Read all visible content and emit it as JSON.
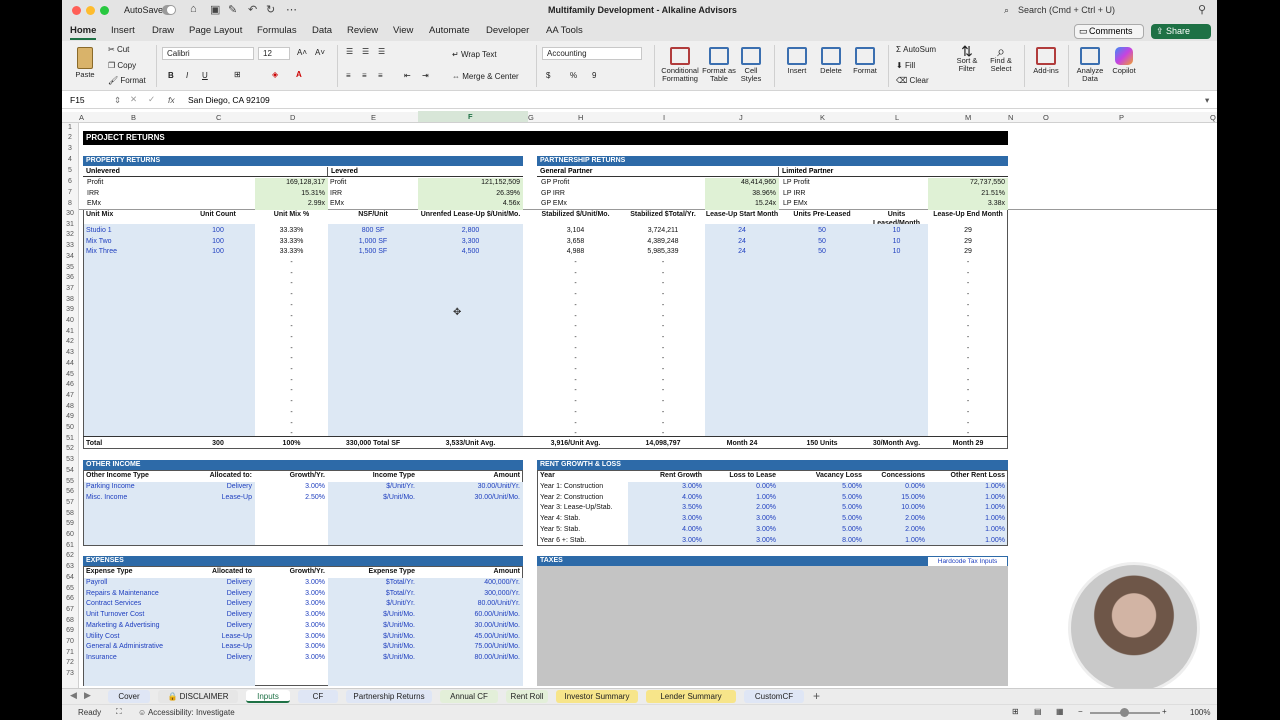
{
  "window": {
    "autosave": "AutoSave",
    "title": "Multifamily Development - Alkaline Advisors",
    "search": "Search (Cmd + Ctrl + U)"
  },
  "menu": {
    "tabs": [
      "Home",
      "Insert",
      "Draw",
      "Page Layout",
      "Formulas",
      "Data",
      "Review",
      "View",
      "Automate",
      "Developer",
      "AA Tools"
    ],
    "comments": "Comments",
    "share": "Share"
  },
  "ribbon": {
    "paste": "Paste",
    "cut": "Cut",
    "copy": "Copy",
    "format": "Format",
    "font": "Calibri",
    "size": "12",
    "wrap": "Wrap Text",
    "merge": "Merge & Center",
    "numfmt": "Accounting",
    "cond": "Conditional Formatting",
    "fmt_table": "Format as Table",
    "cell_styles": "Cell Styles",
    "ins": "Insert",
    "del": "Delete",
    "fmt": "Format",
    "autosum": "AutoSum",
    "fill": "Fill",
    "clear": "Clear",
    "sort": "Sort & Filter",
    "find": "Find & Select",
    "addins": "Add-ins",
    "analyze": "Analyze Data",
    "copilot": "Copilot"
  },
  "formula": {
    "cellref": "F15",
    "fx": "fx",
    "value": "San Diego, CA 92109"
  },
  "columns": [
    "A",
    "B",
    "C",
    "D",
    "E",
    "F",
    "G",
    "H",
    "I",
    "J",
    "K",
    "L",
    "M",
    "N",
    "O",
    "P",
    "Q"
  ],
  "rows_top": [
    "1",
    "2",
    "3",
    "4",
    "5",
    "6",
    "7",
    "8"
  ],
  "rows_main": [
    "30",
    "31",
    "32",
    "33",
    "34",
    "35",
    "36",
    "37",
    "38",
    "39",
    "40",
    "41",
    "42",
    "43",
    "44",
    "45",
    "46",
    "47",
    "48",
    "49",
    "50",
    "51",
    "52",
    "53",
    "54",
    "55",
    "56",
    "57",
    "58",
    "59",
    "60",
    "61",
    "62",
    "63",
    "64",
    "65",
    "66",
    "67",
    "68",
    "69",
    "70",
    "71",
    "72",
    "73"
  ],
  "project_returns": "PROJECT RETURNS",
  "property_returns": {
    "title": "PROPERTY RETURNS",
    "unlevered": "Unlevered",
    "levered": "Levered",
    "labels": [
      "Profit",
      "IRR",
      "EMx"
    ],
    "unlev_vals": [
      "169,128,317",
      "15.31%",
      "2.99x"
    ],
    "lev_vals": [
      "121,152,509",
      "26.39%",
      "4.56x"
    ]
  },
  "partnership_returns": {
    "title": "PARTNERSHIP RETURNS",
    "gp": "General Partner",
    "lp": "Limited Partner",
    "gp_labels": [
      "GP Profit",
      "GP IRR",
      "GP EMx"
    ],
    "gp_vals": [
      "48,414,960",
      "38.96%",
      "15.24x"
    ],
    "lp_labels": [
      "LP Profit",
      "LP IRR",
      "LP EMx"
    ],
    "lp_vals": [
      "72,737,550",
      "21.51%",
      "3.38x"
    ]
  },
  "unit_mix": {
    "headers": [
      "Unit Mix",
      "Unit Count",
      "Unit Mix %",
      "NSF/Unit",
      "Unrenfed Lease-Up $/Unit/Mo.",
      "Stabilized $/Unit/Mo.",
      "Stabilized $Total/Yr.",
      "Lease-Up Start Month",
      "Units Pre-Leased",
      "Units Leased/Month",
      "Lease-Up End Month"
    ],
    "rows": [
      [
        "Studio 1",
        "100",
        "33.33%",
        "800 SF",
        "2,800",
        "3,104",
        "3,724,211",
        "24",
        "50",
        "10",
        "29"
      ],
      [
        "Mix Two",
        "100",
        "33.33%",
        "1,000 SF",
        "3,300",
        "3,658",
        "4,389,248",
        "24",
        "50",
        "10",
        "29"
      ],
      [
        "Mix Three",
        "100",
        "33.33%",
        "1,500 SF",
        "4,500",
        "4,988",
        "5,985,339",
        "24",
        "50",
        "10",
        "29"
      ]
    ],
    "dash": "-",
    "total": [
      "Total",
      "300",
      "100%",
      "330,000 Total SF",
      "3,533/Unit Avg.",
      "3,916/Unit Avg.",
      "14,098,797",
      "Month 24",
      "150 Units",
      "30/Month Avg.",
      "Month 29"
    ]
  },
  "other_income": {
    "title": "OTHER INCOME",
    "headers": [
      "Other Income Type",
      "Allocated to:",
      "Growth/Yr.",
      "Income Type",
      "Amount"
    ],
    "rows": [
      [
        "Parking Income",
        "Delivery",
        "3.00%",
        "$/Unit/Yr.",
        "30.00/Unit/Yr."
      ],
      [
        "Misc. Income",
        "Lease-Up",
        "2.50%",
        "$/Unit/Mo.",
        "30.00/Unit/Mo."
      ]
    ]
  },
  "rent_growth": {
    "title": "RENT GROWTH & LOSS",
    "headers": [
      "Year",
      "Rent Growth",
      "Loss to Lease",
      "Vacancy Loss",
      "Concessions",
      "Other Rent Loss"
    ],
    "rows": [
      [
        "Year 1: Construction",
        "3.00%",
        "0.00%",
        "5.00%",
        "0.00%",
        "1.00%"
      ],
      [
        "Year 2: Construction",
        "4.00%",
        "1.00%",
        "5.00%",
        "15.00%",
        "1.00%"
      ],
      [
        "Year 3: Lease-Up/Stab.",
        "3.50%",
        "2.00%",
        "5.00%",
        "10.00%",
        "1.00%"
      ],
      [
        "Year 4: Stab.",
        "3.00%",
        "3.00%",
        "5.00%",
        "2.00%",
        "1.00%"
      ],
      [
        "Year 5: Stab.",
        "4.00%",
        "3.00%",
        "5.00%",
        "2.00%",
        "1.00%"
      ],
      [
        "Year 6 +: Stab.",
        "3.00%",
        "3.00%",
        "8.00%",
        "1.00%",
        "1.00%"
      ]
    ]
  },
  "expenses": {
    "title": "EXPENSES",
    "headers": [
      "Expense Type",
      "Allocated to",
      "Growth/Yr.",
      "Expense Type",
      "Amount"
    ],
    "rows": [
      [
        "Payroll",
        "Delivery",
        "3.00%",
        "$Total/Yr.",
        "400,000/Yr."
      ],
      [
        "Repairs & Maintenance",
        "Delivery",
        "3.00%",
        "$Total/Yr.",
        "300,000/Yr."
      ],
      [
        "Contract Services",
        "Delivery",
        "3.00%",
        "$/Unit/Yr.",
        "80.00/Unit/Yr."
      ],
      [
        "Unit Turnover Cost",
        "Delivery",
        "3.00%",
        "$/Unit/Mo.",
        "60.00/Unit/Mo."
      ],
      [
        "Marketing & Advertising",
        "Delivery",
        "3.00%",
        "$/Unit/Mo.",
        "30.00/Unit/Mo."
      ],
      [
        "Utility Cost",
        "Lease-Up",
        "3.00%",
        "$/Unit/Mo.",
        "45.00/Unit/Mo."
      ],
      [
        "General & Administrative",
        "Lease-Up",
        "3.00%",
        "$/Unit/Mo.",
        "75.00/Unit/Mo."
      ],
      [
        "Insurance",
        "Delivery",
        "3.00%",
        "$/Unit/Mo.",
        "80.00/Unit/Mo."
      ]
    ]
  },
  "taxes": {
    "title": "TAXES",
    "hardcode": "Hardcode Tax Inputs"
  },
  "sheets": [
    "Cover",
    "DISCLAIMER",
    "Inputs",
    "CF",
    "Partnership Returns",
    "Annual CF",
    "Rent Roll",
    "Investor Summary",
    "Lender Summary",
    "CustomCF"
  ],
  "status": {
    "ready": "Ready",
    "accessibility": "Accessibility: Investigate",
    "zoom": "100%"
  }
}
